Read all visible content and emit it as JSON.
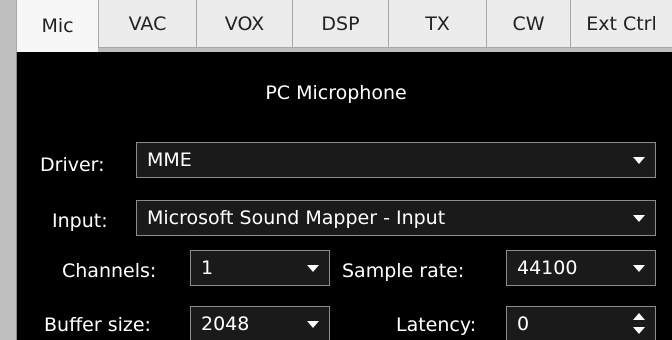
{
  "tabs": [
    {
      "label": "Mic",
      "active": true
    },
    {
      "label": "VAC",
      "active": false
    },
    {
      "label": "VOX",
      "active": false
    },
    {
      "label": "DSP",
      "active": false
    },
    {
      "label": "TX",
      "active": false
    },
    {
      "label": "CW",
      "active": false
    },
    {
      "label": "Ext Ctrl",
      "active": false
    }
  ],
  "section": {
    "title": "PC Microphone"
  },
  "fields": {
    "driver": {
      "label": "Driver:",
      "value": "MME"
    },
    "input": {
      "label": "Input:",
      "value": "Microsoft Sound Mapper - Input"
    },
    "channels": {
      "label": "Channels:",
      "value": "1"
    },
    "sample_rate": {
      "label": "Sample rate:",
      "value": "44100"
    },
    "buffer_size": {
      "label": "Buffer size:",
      "value": "2048"
    },
    "latency": {
      "label": "Latency:",
      "value": "0"
    }
  },
  "icons": {
    "dropdown": "chevron-down-icon",
    "spinner": "spin-updown-icon"
  },
  "colors": {
    "panel_bg": "#000000",
    "tab_bg": "#ececec",
    "tab_active_bg": "#f7f7f7",
    "control_bg": "#1a1a1a",
    "text_light": "#ffffff"
  }
}
